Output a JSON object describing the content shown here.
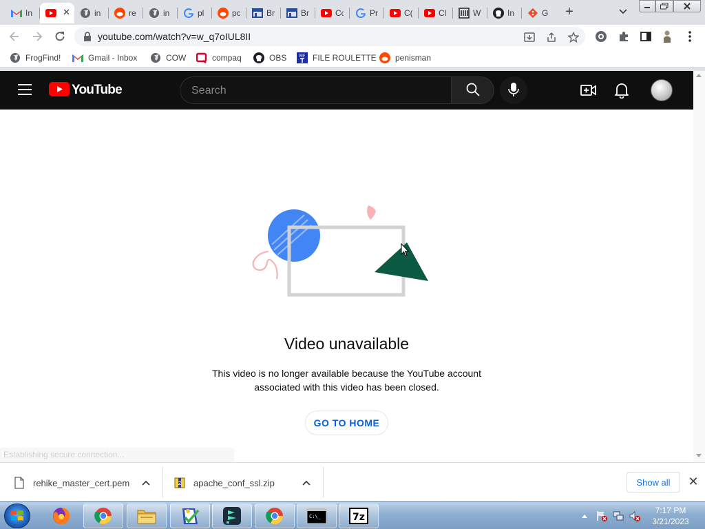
{
  "browser": {
    "tabs": [
      {
        "label": "In",
        "icon": "gmail-icon"
      },
      {
        "label": "",
        "icon": "youtube-icon",
        "active": true
      },
      {
        "label": "in",
        "icon": "globe-icon"
      },
      {
        "label": "re",
        "icon": "reddit-icon"
      },
      {
        "label": "in",
        "icon": "globe-icon"
      },
      {
        "label": "pl",
        "icon": "google-icon"
      },
      {
        "label": "pc",
        "icon": "reddit-icon"
      },
      {
        "label": "Br",
        "icon": "window-icon"
      },
      {
        "label": "Br",
        "icon": "window-icon"
      },
      {
        "label": "Cc",
        "icon": "youtube-icon"
      },
      {
        "label": "Pr",
        "icon": "google-icon"
      },
      {
        "label": "C(",
        "icon": "youtube-icon"
      },
      {
        "label": "Cl",
        "icon": "youtube-icon"
      },
      {
        "label": "W",
        "icon": "wikipedia-icon"
      },
      {
        "label": "In",
        "icon": "github-icon"
      },
      {
        "label": "G",
        "icon": "git-icon"
      }
    ],
    "url": "youtube.com/watch?v=w_q7oIUL8II",
    "bookmarks": [
      {
        "label": "FrogFind!",
        "icon": "globe-icon"
      },
      {
        "label": "Gmail - Inbox",
        "icon": "gmail-icon"
      },
      {
        "label": "COW",
        "icon": "globe-icon"
      },
      {
        "label": "compaq",
        "icon": "compaq-icon"
      },
      {
        "label": "OBS",
        "icon": "github-icon"
      },
      {
        "label": "FILE ROULETTE",
        "icon": "file-roulette-icon"
      },
      {
        "label": "penisman",
        "icon": "reddit-icon"
      }
    ]
  },
  "youtube": {
    "logo_text": "YouTube",
    "search_placeholder": "Search",
    "error_title": "Video unavailable",
    "error_message": "This video is no longer available because the YouTube account associated with this video has been closed.",
    "go_home_label": "GO TO HOME"
  },
  "status_bubble": "Establishing secure connection...",
  "downloads": {
    "items": [
      {
        "filename": "rehike_master_cert.pem",
        "icon": "file-icon"
      },
      {
        "filename": "apache_conf_ssl.zip",
        "icon": "zip-archive-icon"
      }
    ],
    "show_all_label": "Show all"
  },
  "taskbar": {
    "apps": [
      "firefox-icon",
      "chrome-icon",
      "file-explorer-icon",
      "notepad-check-icon",
      "filmora-icon",
      "chrome-icon",
      "command-prompt-icon",
      "7zip-icon"
    ],
    "clock_time": "7:17 PM",
    "clock_date": "3/21/2023",
    "cmd_prompt_text": "C:\\_",
    "sevenzip_text": "7z"
  },
  "colors": {
    "youtube_red": "#ff0000",
    "youtube_header": "#0f0f0f",
    "link_blue": "#065fd4",
    "illus_blue": "#4285f4",
    "illus_green": "#0b5a41",
    "illus_pink": "#f7b3b5"
  }
}
